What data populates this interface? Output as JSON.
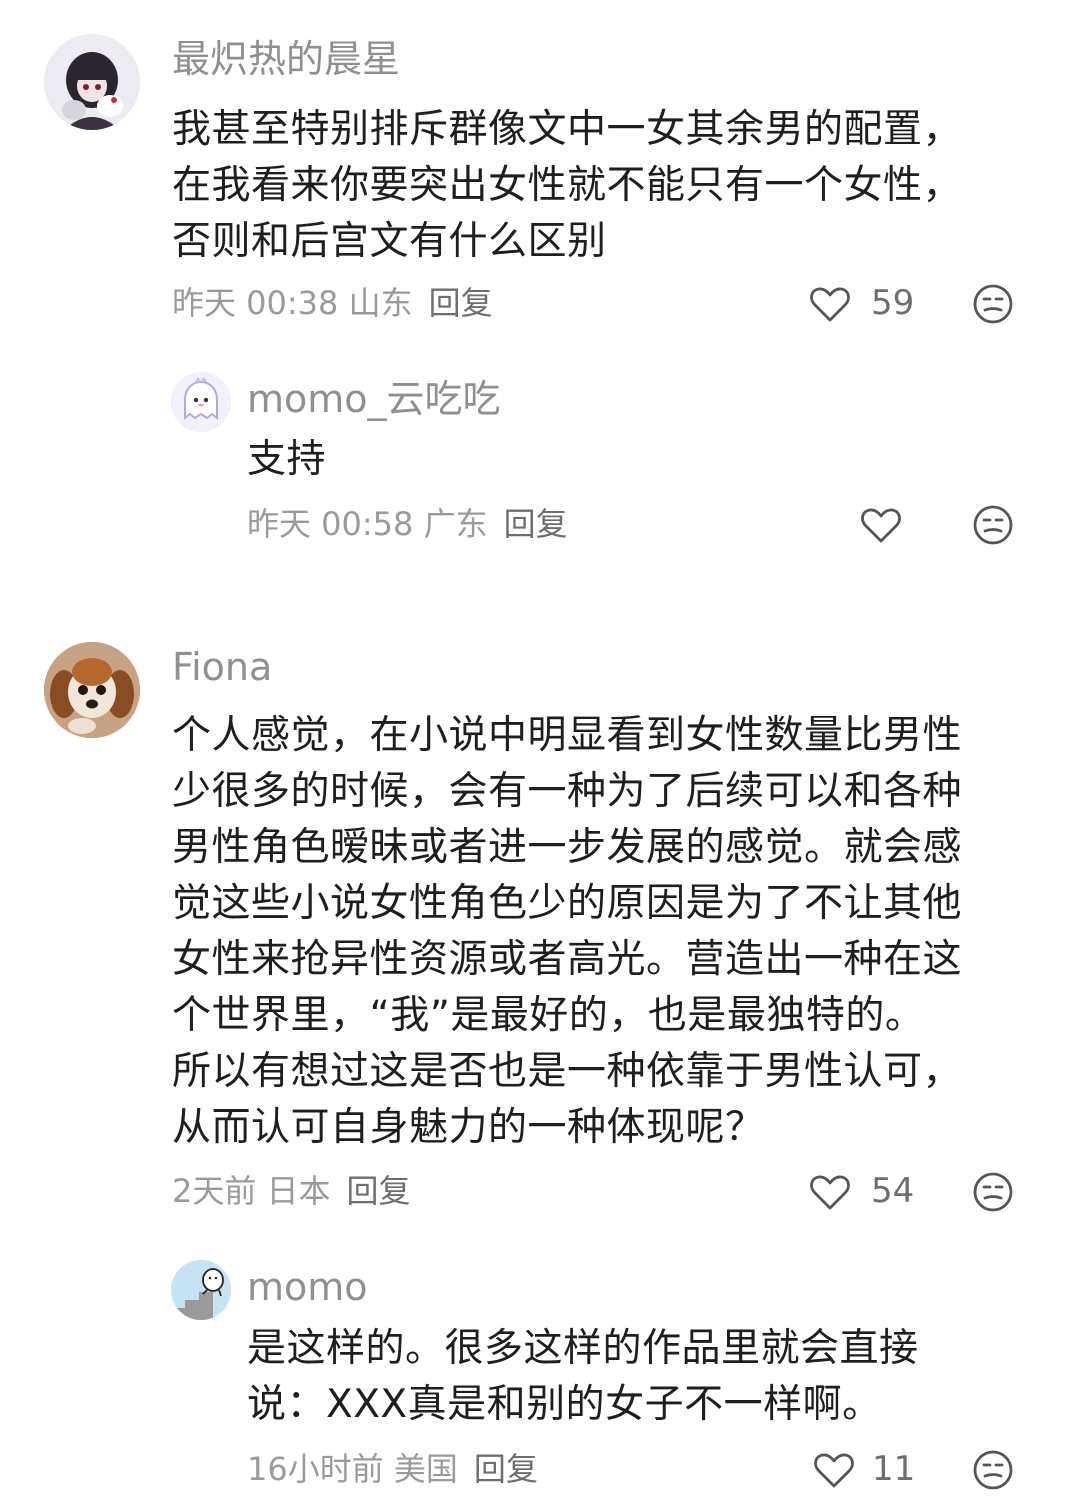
{
  "comments": [
    {
      "username": "最炽热的晨星",
      "lines": [
        "我甚至特别排斥群像文中一女其余男的配置，",
        "在我看来你要突出女性就不能只有一个女性，",
        "否则和后宫文有什么区别"
      ],
      "meta": "昨天 00:38 山东",
      "reply_label": "回复",
      "likes": "59",
      "avatar_icon": "anime-girl-avatar",
      "replies": [
        {
          "username": "momo_云吃吃",
          "lines": [
            "支持"
          ],
          "meta": "昨天 00:58 广东",
          "reply_label": "回复",
          "likes": "",
          "avatar_icon": "cartoon-ghost-avatar"
        }
      ]
    },
    {
      "username": "Fiona",
      "lines": [
        "个人感觉，在小说中明显看到女性数量比男性",
        "少很多的时候，会有一种为了后续可以和各种",
        "男性角色暧昧或者进一步发展的感觉。就会感",
        "觉这些小说女性角色少的原因是为了不让其他",
        "女性来抢异性资源或者高光。营造出一种在这",
        "个世界里，“我”是最好的，也是最独特的。",
        "所以有想过这是否也是一种依靠于男性认可，",
        "从而认可自身魅力的一种体现呢？"
      ],
      "meta": "2天前 日本",
      "reply_label": "回复",
      "likes": "54",
      "avatar_icon": "puppy-avatar",
      "replies": [
        {
          "username": "momo",
          "lines": [
            "是这样的。很多这样的作品里就会直接",
            "说：XXX真是和别的女子不一样啊。"
          ],
          "meta": "16小时前 美国",
          "reply_label": "回复",
          "likes": "11",
          "avatar_icon": "stairs-character-avatar"
        }
      ]
    }
  ],
  "colors": {
    "username": "#8f8f8f",
    "meta": "#9a9a9a",
    "icon_stroke": "#555555"
  }
}
